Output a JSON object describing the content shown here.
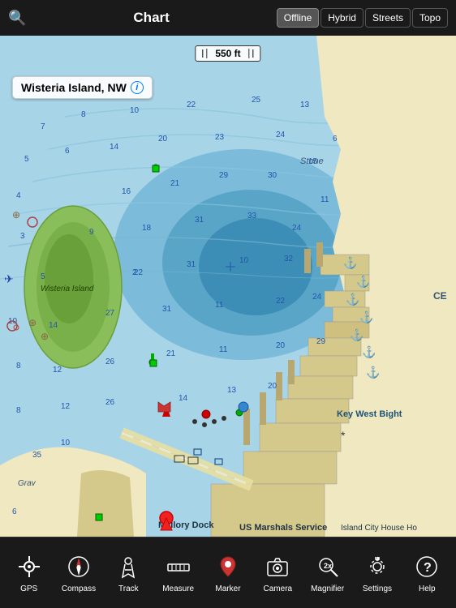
{
  "header": {
    "title": "Chart",
    "search_icon": "🔍",
    "modes": [
      {
        "label": "Offline",
        "active": true
      },
      {
        "label": "Hybrid",
        "active": false
      },
      {
        "label": "Streets",
        "active": false
      },
      {
        "label": "Topo",
        "active": false
      }
    ]
  },
  "map": {
    "distance_label": "550 ft",
    "location_label": "Wisteria Island, NW",
    "key_west_label": "Key West Bight",
    "mallory_dock_label": "Mallory Dock",
    "us_marshals_label": "US Marshals Service",
    "island_city_label": "Island City House Ho",
    "wisteria_island_label": "Wisteria Island",
    "stone_label": "Stone",
    "gravy_label": "Grav"
  },
  "toolbar": {
    "items": [
      {
        "label": "GPS",
        "icon": "📍"
      },
      {
        "label": "Compass",
        "icon": "🧭"
      },
      {
        "label": "Track",
        "icon": "🚶"
      },
      {
        "label": "Measure",
        "icon": "📏"
      },
      {
        "label": "Marker",
        "icon": "📌"
      },
      {
        "label": "Camera",
        "icon": "📷"
      },
      {
        "label": "Magnifier",
        "icon": "🔍"
      },
      {
        "label": "Settings",
        "icon": "⚙️"
      },
      {
        "label": "Help",
        "icon": "❓"
      }
    ]
  }
}
